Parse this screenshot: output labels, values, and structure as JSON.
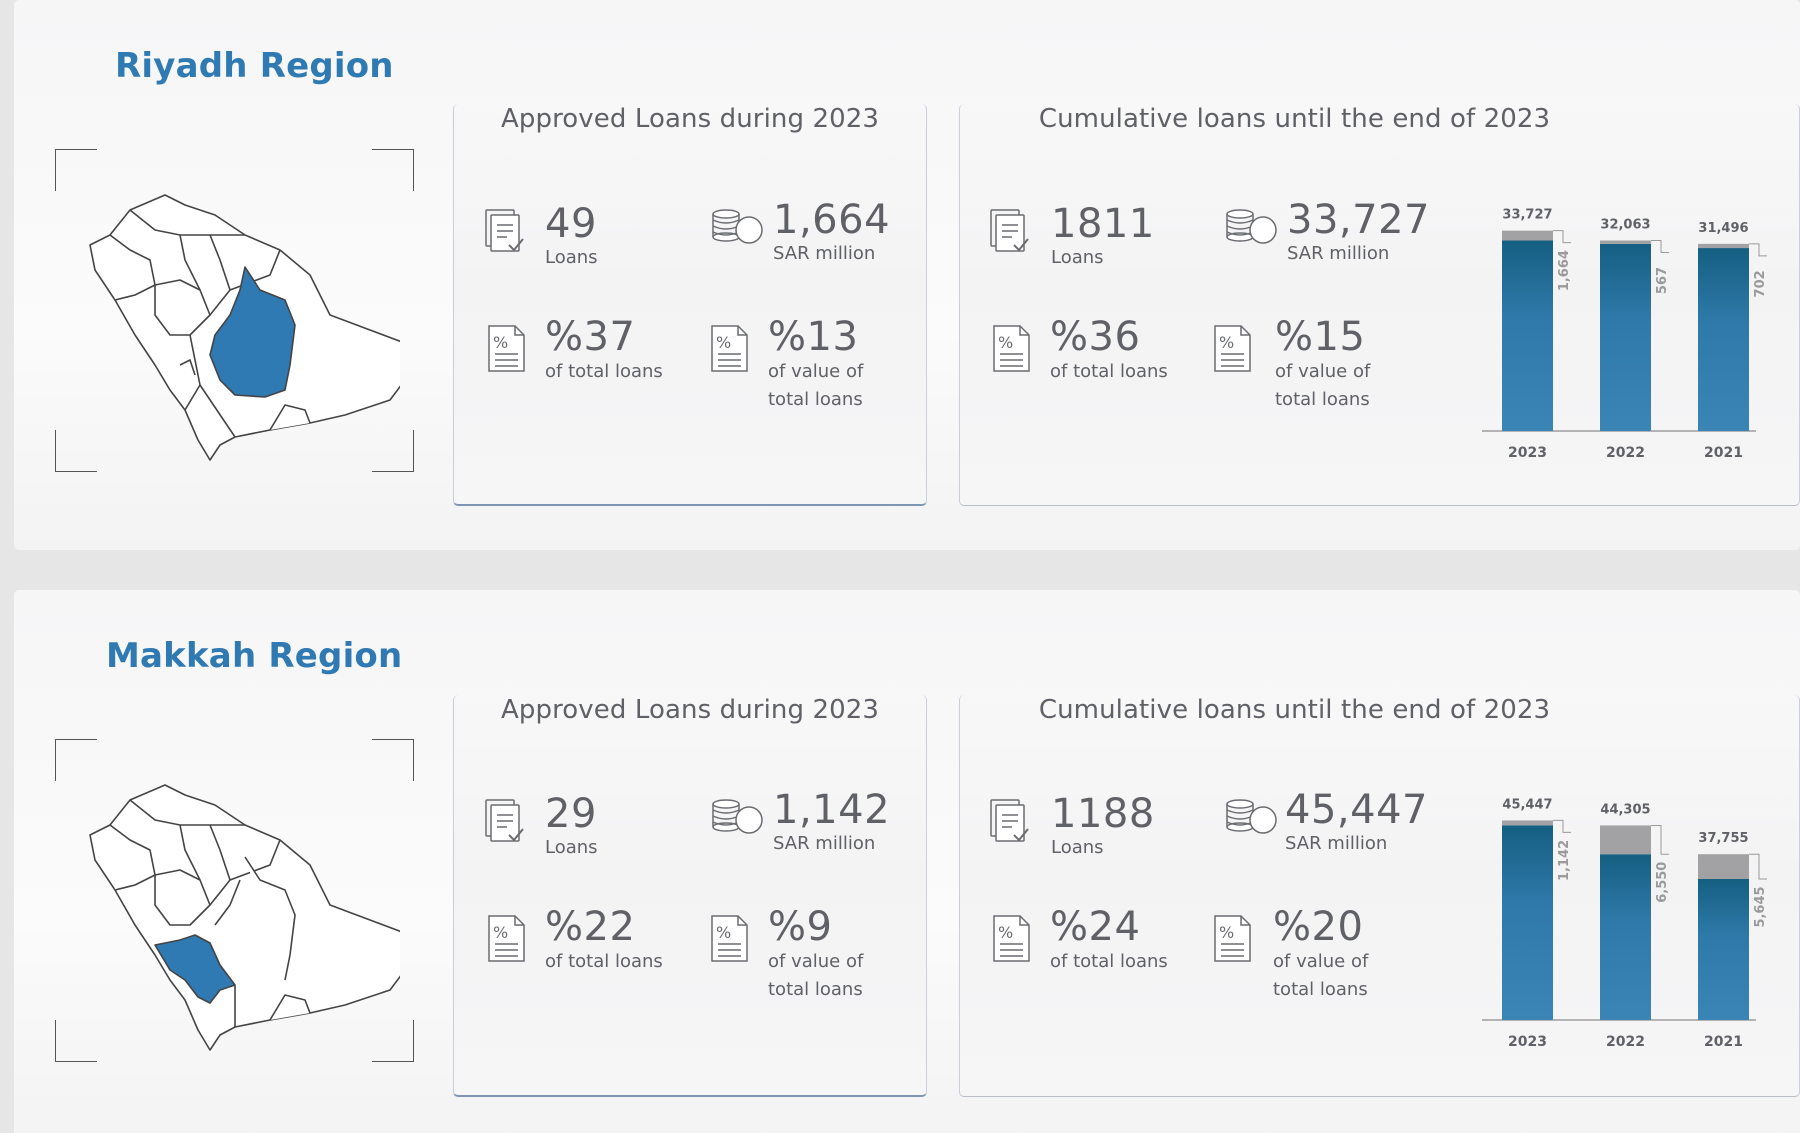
{
  "regions": [
    {
      "name": "Riyadh Region",
      "approved": {
        "title": "Approved Loans during 2023",
        "loans_value": "49",
        "loans_label": "Loans",
        "amount_value": "1,664",
        "amount_label": "SAR million",
        "pct_loans_value": "%37",
        "pct_loans_label": "of total loans",
        "pct_value_value": "%13",
        "pct_value_label1": "of value of",
        "pct_value_label2": "total loans"
      },
      "cumulative": {
        "title": "Cumulative loans until the end of 2023",
        "loans_value": "1811",
        "loans_label": "Loans",
        "amount_value": "33,727",
        "amount_label": "SAR million",
        "pct_loans_value": "%36",
        "pct_loans_label": "of total loans",
        "pct_value_value": "%15",
        "pct_value_label1": "of value of",
        "pct_value_label2": "total loans"
      }
    },
    {
      "name": "Makkah Region",
      "approved": {
        "title": "Approved Loans during 2023",
        "loans_value": "29",
        "loans_label": "Loans",
        "amount_value": "1,142",
        "amount_label": "SAR million",
        "pct_loans_value": "%22",
        "pct_loans_label": "of total loans",
        "pct_value_value": "%9",
        "pct_value_label1": "of value of",
        "pct_value_label2": "total loans"
      },
      "cumulative": {
        "title": "Cumulative loans until the end of 2023",
        "loans_value": "1188",
        "loans_label": "Loans",
        "amount_value": "45,447",
        "amount_label": "SAR million",
        "pct_loans_value": "%24",
        "pct_loans_label": "of total loans",
        "pct_value_value": "%20",
        "pct_value_label1": "of value of",
        "pct_value_label2": "total loans"
      }
    }
  ],
  "colors": {
    "title_blue": "#2f7ab3",
    "bar_top": "#155f82",
    "bar_bottom": "#3a85b6",
    "bar_increment": "#a2a2a4",
    "map_highlight": "#2f7ab3",
    "text": "#5f6166"
  },
  "icons": [
    "document-check-icon",
    "coins-icon",
    "percent-document-icon"
  ],
  "chart_data": [
    {
      "type": "bar",
      "stacked": true,
      "categories": [
        "2023",
        "2022",
        "2021"
      ],
      "totals": [
        33727,
        32063,
        31496
      ],
      "total_labels": [
        "33,727",
        "32,063",
        "31,496"
      ],
      "series": [
        {
          "values": [
            32063,
            31496,
            30794
          ]
        },
        {
          "values": [
            1664,
            567,
            702
          ]
        }
      ],
      "increment_labels": [
        "1,664",
        "567",
        "702"
      ],
      "ylim": [
        0,
        34000
      ]
    },
    {
      "type": "bar",
      "stacked": true,
      "categories": [
        "2023",
        "2022",
        "2021"
      ],
      "totals": [
        45447,
        44305,
        37755
      ],
      "total_labels": [
        "45,447",
        "44,305",
        "37,755"
      ],
      "series": [
        {
          "values": [
            44305,
            37755,
            32110
          ]
        },
        {
          "values": [
            1142,
            6550,
            5645
          ]
        }
      ],
      "increment_labels": [
        "1,142",
        "6,550",
        "5,645"
      ],
      "ylim": [
        0,
        46000
      ]
    }
  ]
}
